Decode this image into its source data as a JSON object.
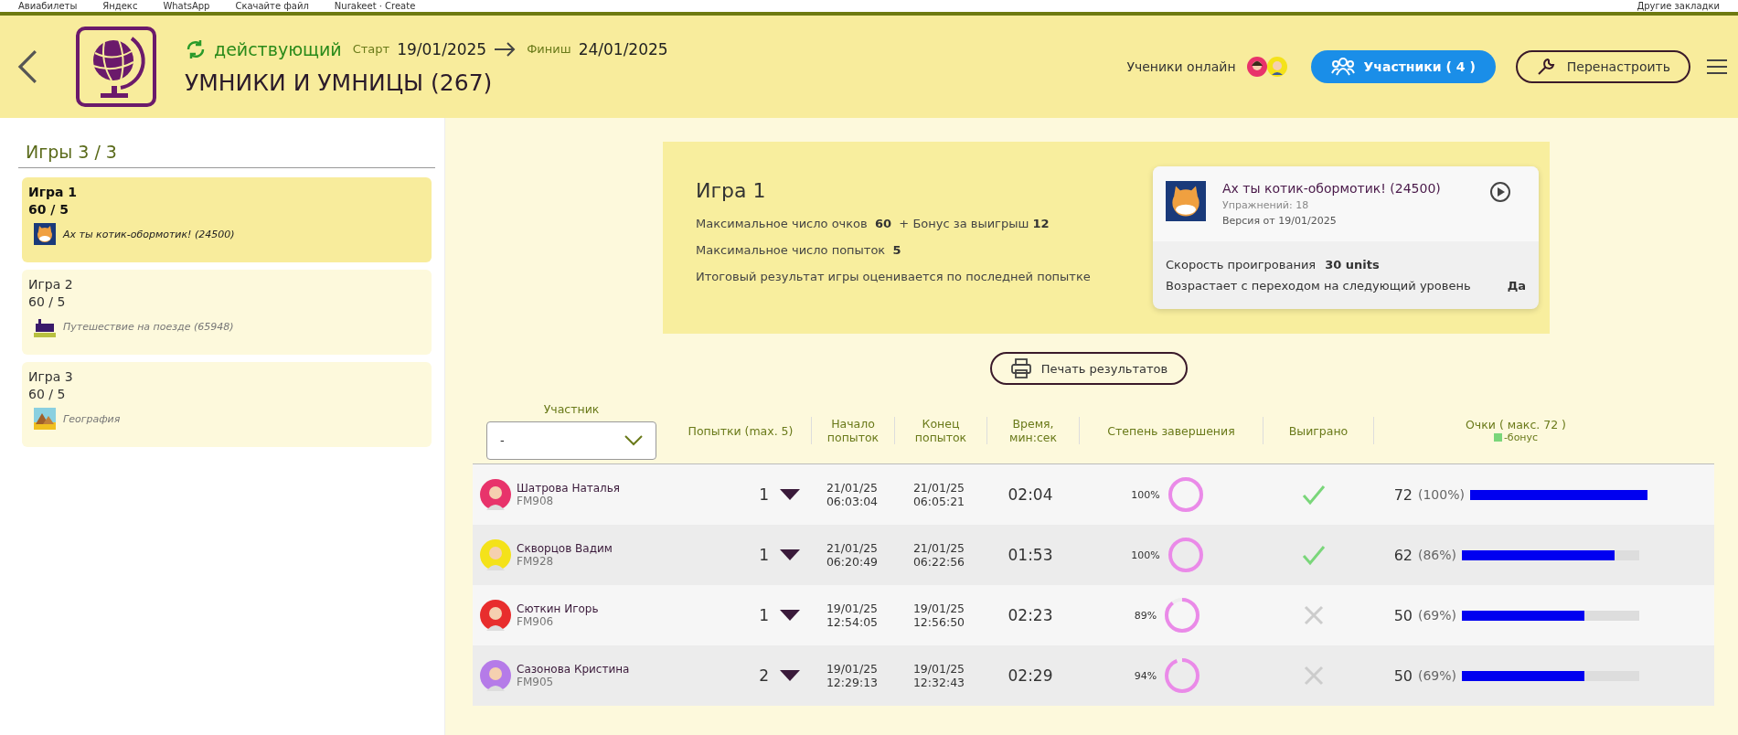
{
  "bookmarks": [
    "Авиабилеты",
    "Яндекс",
    "WhatsApp",
    "Скачайте файл",
    "Nurakeet · Create"
  ],
  "bookmarks_other": "Другие закладки",
  "header": {
    "status": "действующий",
    "start_label": "Старт",
    "start": "19/01/2025",
    "finish_label": "Финиш",
    "finish": "24/01/2025",
    "title": "УМНИКИ И УМНИЦЫ (267)",
    "online_label": "Ученики онлайн",
    "participants_button": "Участники ( 4 )",
    "reconfigure_button": "Перенастроить"
  },
  "sidebar": {
    "title": "Игры 3 / 3",
    "items": [
      {
        "name": "Игра 1",
        "score": "60 / 5",
        "game": "Ах ты котик-обормотик! (24500)",
        "kind": "cat",
        "selected": true
      },
      {
        "name": "Игра 2",
        "score": "60 / 5",
        "game": "Путешествие на поезде (65948)",
        "kind": "train",
        "selected": false
      },
      {
        "name": "Игра 3",
        "score": "60 / 5",
        "game": "География",
        "kind": "pyramids",
        "selected": false
      }
    ]
  },
  "game_info": {
    "title": "Игра 1",
    "lines": [
      "Максимальное число очков  **60**  + Бонус за выигрыш **12**",
      "Максимальное число попыток  **5**",
      "Итоговый результат игры оценивается по последней попытке"
    ],
    "card": {
      "title": "Ах ты котик-обормотик! (24500)",
      "exercises": "Упражнений: 18",
      "version": "Версия от 19/01/2025",
      "speed_label": "Скорость проигрования",
      "speed": "30 units",
      "grows_label": "Возрастает с переходом на следующий уровень",
      "grows": "Да"
    }
  },
  "print_button": "Печать результатов",
  "table": {
    "participant_header": "Участник",
    "filter_value": "-",
    "columns": [
      "Попытки (max. 5)",
      "Начало попыток",
      "Конец попыток",
      "Время, мин:сек",
      "Степень завершения",
      "Выиграно",
      "Очки ( макс. 72 )"
    ],
    "bonus_legend": "-бонус",
    "rows": [
      {
        "name": "Шатрова Наталья",
        "code": "FM908",
        "attempts": "1",
        "start_date": "21/01/25",
        "start_time": "06:03:04",
        "end_date": "21/01/25",
        "end_time": "06:05:21",
        "duration": "02:04",
        "completion": {
          "text": "100%",
          "level": 1.0
        },
        "won": true,
        "score": "72",
        "percent": "(100%)",
        "level": 1.0
      },
      {
        "name": "Скворцов Вадим",
        "code": "FM928",
        "attempts": "1",
        "start_date": "21/01/25",
        "start_time": "06:20:49",
        "end_date": "21/01/25",
        "end_time": "06:22:56",
        "duration": "01:53",
        "completion": {
          "text": "100%",
          "level": 1.0
        },
        "won": true,
        "score": "62",
        "percent": "(86%)",
        "level": 0.86
      },
      {
        "name": "Сюткин Игорь",
        "code": "FM906",
        "attempts": "1",
        "start_date": "19/01/25",
        "start_time": "12:54:05",
        "end_date": "19/01/25",
        "end_time": "12:56:50",
        "duration": "02:23",
        "completion": {
          "text": "89%",
          "level": 0.89
        },
        "won": false,
        "score": "50",
        "percent": "(69%)",
        "level": 0.69
      },
      {
        "name": "Сазонова Кристина",
        "code": "FM905",
        "attempts": "2",
        "start_date": "19/01/25",
        "start_time": "12:29:13",
        "end_date": "19/01/25",
        "end_time": "12:32:43",
        "duration": "02:29",
        "completion": {
          "text": "94%",
          "level": 0.94
        },
        "won": false,
        "score": "50",
        "percent": "(69%)",
        "level": 0.69
      }
    ]
  }
}
